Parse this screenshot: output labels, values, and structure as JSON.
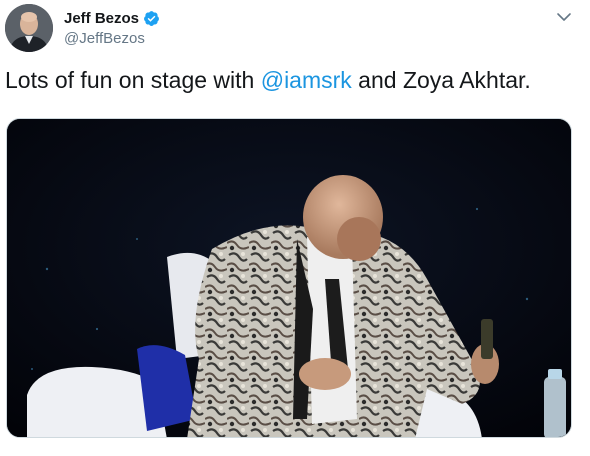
{
  "author": {
    "display_name": "Jeff Bezos",
    "handle": "@JeffBezos",
    "verified": true
  },
  "tweet": {
    "text_before": "Lots of fun on stage with ",
    "mention": "@iamsrk",
    "text_after": " and Zoya Akhtar."
  },
  "icons": {
    "verified": "verified-badge-icon",
    "menu": "chevron-down-icon"
  },
  "colors": {
    "link": "#1b95e0",
    "verified": "#1da1f2",
    "secondary_text": "#657786"
  }
}
